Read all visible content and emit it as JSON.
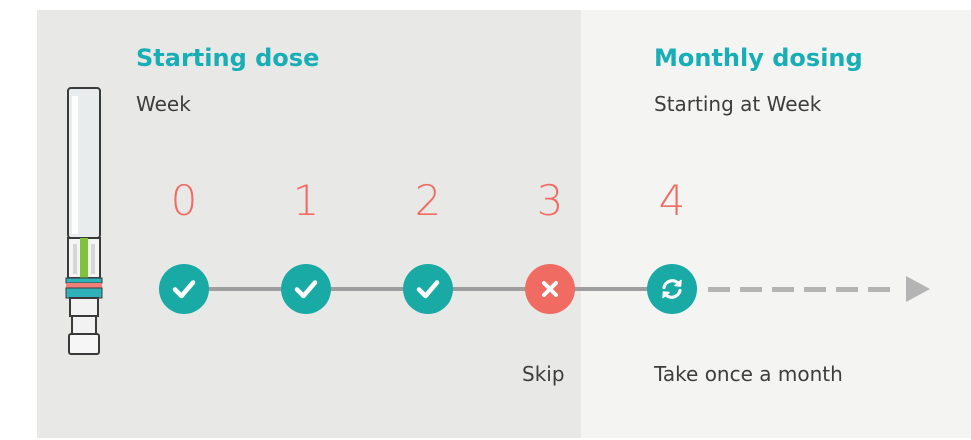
{
  "starting": {
    "title": "Starting dose",
    "subtitle": "Week"
  },
  "monthly": {
    "title": "Monthly dosing",
    "subtitle": "Starting at Week"
  },
  "weeks": [
    "0",
    "1",
    "2",
    "3",
    "4"
  ],
  "steps": [
    {
      "week": "0",
      "status": "taken",
      "icon": "check-icon",
      "color": "#19aaa5"
    },
    {
      "week": "1",
      "status": "taken",
      "icon": "check-icon",
      "color": "#19aaa5"
    },
    {
      "week": "2",
      "status": "taken",
      "icon": "check-icon",
      "color": "#19aaa5"
    },
    {
      "week": "3",
      "status": "skip",
      "icon": "x-icon",
      "color": "#f06b62"
    },
    {
      "week": "4",
      "status": "monthly",
      "icon": "refresh-icon",
      "color": "#19aaa5"
    }
  ],
  "captions": {
    "skip": "Skip",
    "monthly": "Take once a month"
  },
  "colors": {
    "accent": "#17aeb6",
    "week_number": "#f06b62",
    "teal": "#19aaa5",
    "coral": "#f06b62"
  }
}
